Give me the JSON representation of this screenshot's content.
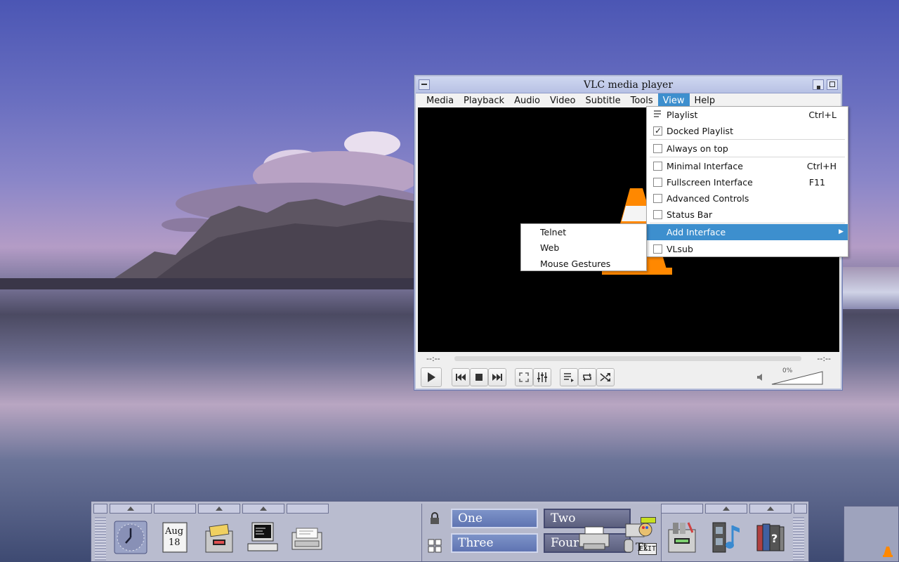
{
  "window": {
    "title": "VLC media player"
  },
  "menubar": [
    {
      "label": "Media"
    },
    {
      "label": "Playback"
    },
    {
      "label": "Audio"
    },
    {
      "label": "Video"
    },
    {
      "label": "Subtitle"
    },
    {
      "label": "Tools"
    },
    {
      "label": "View"
    },
    {
      "label": "Help"
    }
  ],
  "view_menu": {
    "items": [
      {
        "label": "Playlist",
        "shortcut": "Ctrl+L",
        "kind": "icon"
      },
      {
        "label": "Docked Playlist",
        "shortcut": "",
        "kind": "check",
        "checked": true
      },
      {
        "label": "Always on top",
        "shortcut": "",
        "kind": "check",
        "checked": false
      },
      {
        "label": "Minimal Interface",
        "shortcut": "Ctrl+H",
        "kind": "check",
        "checked": false
      },
      {
        "label": "Fullscreen Interface",
        "shortcut": "F11",
        "kind": "check",
        "checked": false
      },
      {
        "label": "Advanced Controls",
        "shortcut": "",
        "kind": "check",
        "checked": false
      },
      {
        "label": "Status Bar",
        "shortcut": "",
        "kind": "check",
        "checked": false
      },
      {
        "label": "Add Interface",
        "shortcut": "",
        "kind": "submenu",
        "highlighted": true
      },
      {
        "label": "VLsub",
        "shortcut": "",
        "kind": "check",
        "checked": false
      }
    ]
  },
  "add_interface_menu": {
    "items": [
      {
        "label": "Telnet"
      },
      {
        "label": "Web"
      },
      {
        "label": "Mouse Gestures"
      }
    ]
  },
  "player": {
    "time_elapsed": "--:--",
    "time_total": "--:--",
    "volume": "0%"
  },
  "pager": {
    "desktops": [
      {
        "label": "One",
        "selected": true
      },
      {
        "label": "Two",
        "selected": false
      },
      {
        "label": "Three",
        "selected": true
      },
      {
        "label": "Four",
        "selected": false
      }
    ],
    "exit_label": "EXIT"
  },
  "dock": {
    "calendar_month": "Aug",
    "calendar_day": "18"
  },
  "colors": {
    "menu_highlight": "#3d8fce",
    "titlebar": "#c3cbea",
    "dock": "#b9bccf"
  }
}
